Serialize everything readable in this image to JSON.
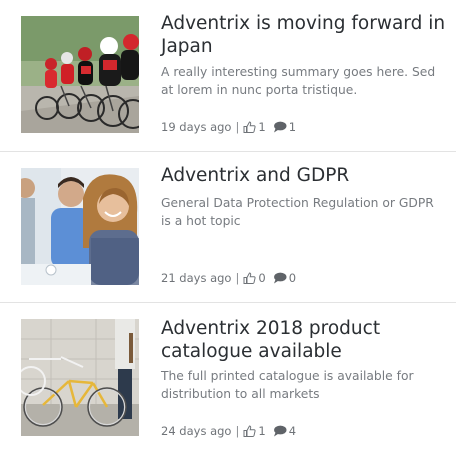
{
  "articles": [
    {
      "title": "Adventrix is moving forward in Japan",
      "summary": "A really interesting summary goes here. Sed at lorem in nunc porta tristique.",
      "age": "19 days ago",
      "separator": "|",
      "likes": "1",
      "comments": "1",
      "thumbnail_subject": "cyclists racing"
    },
    {
      "title": "Adventrix and GDPR",
      "summary": "General Data Protection Regulation or GDPR is a hot topic",
      "age": "21 days ago",
      "separator": "|",
      "likes": "0",
      "comments": "0",
      "thumbnail_subject": "people in office meeting"
    },
    {
      "title": "Adventrix 2018 product catalogue available",
      "summary": "The full printed catalogue is available for distribution to all markets",
      "age": "24 days ago",
      "separator": "|",
      "likes": "1",
      "comments": "4",
      "thumbnail_subject": "bicycles against wall"
    }
  ],
  "icons": {
    "like": "thumbs-up-icon",
    "comment": "comment-bubble-icon"
  },
  "colors": {
    "title": "#2b2f33",
    "summary": "#777b80",
    "meta": "#6f7378",
    "divider": "#e3e3e3"
  }
}
